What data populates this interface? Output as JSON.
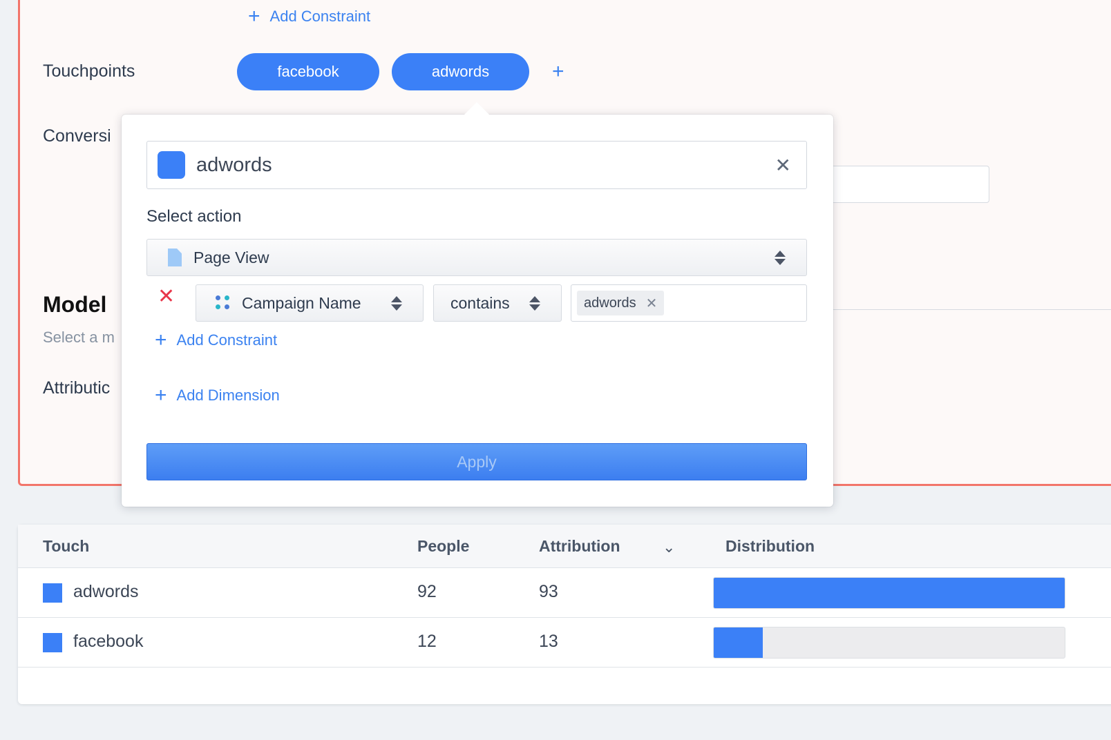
{
  "background_panel": {
    "top_add_constraint": "Add Constraint",
    "touchpoints_label": "Touchpoints",
    "touchpoint_pills": [
      "facebook",
      "adwords"
    ],
    "add_touchpoint": "+",
    "conversion_label_partial": "Conversi",
    "model_title": "Model",
    "model_subtitle_partial": "Select a m",
    "attribution_label_partial": "Attributic"
  },
  "popover": {
    "touchpoint_name": "adwords",
    "clear_icon": "close-icon",
    "select_action_label": "Select action",
    "action_value": "Page View",
    "constraint": {
      "property": "Campaign Name",
      "operator": "contains",
      "value_tag": "adwords"
    },
    "add_constraint": "Add Constraint",
    "add_dimension": "Add Dimension",
    "apply": "Apply"
  },
  "table": {
    "headers": {
      "touch": "Touch",
      "people": "People",
      "attribution": "Attribution",
      "distribution": "Distribution"
    },
    "rows": [
      {
        "touch": "adwords",
        "people": "92",
        "attribution": "93",
        "distribution_fraction": 1.0
      },
      {
        "touch": "facebook",
        "people": "12",
        "attribution": "13",
        "distribution_fraction": 0.14
      }
    ]
  },
  "colors": {
    "accent_blue": "#3b80f7",
    "alert_red": "#e8364a",
    "panel_border": "#f2756a"
  }
}
